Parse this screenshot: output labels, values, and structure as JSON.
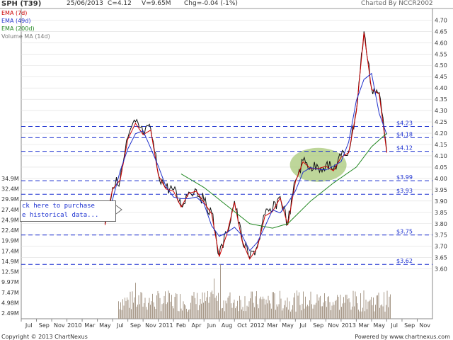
{
  "header": {
    "symbol": "SPH (T39)",
    "date": "25/06/2013",
    "close": "C=4.12",
    "volume": "V=9.65M",
    "change": "Chg=-0.04 (-1%)",
    "credit": "Charted By NCCR2002"
  },
  "legend": [
    {
      "label": "EMA (7d)",
      "color": "#cc0000"
    },
    {
      "label": "EMA (49d)",
      "color": "#2233cc"
    },
    {
      "label": "EMA (200d)",
      "color": "#228822"
    },
    {
      "label": "Volume MA (14d)",
      "color": "#777777"
    }
  ],
  "callout": {
    "line1": "ck here to purchase",
    "line2": "e historical data..."
  },
  "footer": {
    "copyright": "Copyright © 2013 ChartNexus",
    "powered": "Powered by www.chartnexus.com"
  },
  "colors": {
    "price": "#111111",
    "support_line": "#1a2fd0",
    "highlight": "#a8c878"
  },
  "chart_data": {
    "type": "line",
    "title": "SPH (T39)",
    "price_axis": {
      "ticks": [
        "4.70",
        "4.65",
        "4.60",
        "4.55",
        "4.50",
        "4.45",
        "4.40",
        "4.35",
        "4.30",
        "4.25",
        "4.20",
        "4.15",
        "4.10",
        "4.05",
        "4.00",
        "3.95",
        "3.90",
        "3.85",
        "3.80",
        "3.75",
        "3.70",
        "3.65",
        "3.60"
      ],
      "ylim": [
        3.58,
        4.72
      ]
    },
    "volume_axis": {
      "ticks": [
        "34.9M",
        "32.4M",
        "29.9M",
        "27.4M",
        "24.9M",
        "22.4M",
        "19.9M",
        "17.4M",
        "14.9M",
        "12.5M",
        "9.97M",
        "7.47M",
        "4.98M",
        "2.49M"
      ]
    },
    "x_axis_labels": [
      "Jul",
      "Sep",
      "Nov",
      "2010",
      "Mar",
      "May",
      "Jul",
      "Sep",
      "Nov",
      "2011",
      "Feb",
      "Apr",
      "Jun",
      "Aug",
      "Oct",
      "2012",
      "Mar",
      "May",
      "Jul",
      "Sep",
      "Nov",
      "2013",
      "Mar",
      "May",
      "Jul",
      "Sep",
      "Nov"
    ],
    "support_levels": [
      {
        "label": "$4.23",
        "value": 4.23
      },
      {
        "label": "$4.18",
        "value": 4.18
      },
      {
        "label": "$4.12",
        "value": 4.12
      },
      {
        "label": "$3.99",
        "value": 3.99
      },
      {
        "label": "$3.93",
        "value": 3.93
      },
      {
        "label": "$3.75",
        "value": 3.75
      },
      {
        "label": "$3.62",
        "value": 3.62
      }
    ],
    "price_series": [
      {
        "period": "May 2010",
        "value": 3.8
      },
      {
        "period": "Jun 2010",
        "value": 3.96
      },
      {
        "period": "Jul 2010",
        "value": 4.0
      },
      {
        "period": "Aug 2010",
        "value": 4.18
      },
      {
        "period": "Sep 2010",
        "value": 4.25
      },
      {
        "period": "Oct 2010",
        "value": 4.2
      },
      {
        "period": "Nov 2010",
        "value": 4.22
      },
      {
        "period": "Dec 2010",
        "value": 4.02
      },
      {
        "period": "Jan 2011",
        "value": 3.96
      },
      {
        "period": "Feb 2011",
        "value": 3.95
      },
      {
        "period": "Mar 2011",
        "value": 3.88
      },
      {
        "period": "Apr 2011",
        "value": 3.94
      },
      {
        "period": "May 2011",
        "value": 3.95
      },
      {
        "period": "Jun 2011",
        "value": 3.9
      },
      {
        "period": "Jul 2011",
        "value": 3.85
      },
      {
        "period": "Aug 2011",
        "value": 3.66
      },
      {
        "period": "Sep 2011",
        "value": 3.76
      },
      {
        "period": "Oct 2011",
        "value": 3.9
      },
      {
        "period": "Nov 2011",
        "value": 3.73
      },
      {
        "period": "Dec 2011",
        "value": 3.65
      },
      {
        "period": "Jan 2012",
        "value": 3.7
      },
      {
        "period": "Feb 2012",
        "value": 3.84
      },
      {
        "period": "Mar 2012",
        "value": 3.86
      },
      {
        "period": "Apr 2012",
        "value": 3.92
      },
      {
        "period": "May 2012",
        "value": 3.8
      },
      {
        "period": "Jun 2012",
        "value": 3.99
      },
      {
        "period": "Jul 2012",
        "value": 4.08
      },
      {
        "period": "Aug 2012",
        "value": 4.05
      },
      {
        "period": "Sep 2012",
        "value": 4.05
      },
      {
        "period": "Oct 2012",
        "value": 4.06
      },
      {
        "period": "Nov 2012",
        "value": 4.04
      },
      {
        "period": "Dec 2012",
        "value": 4.1
      },
      {
        "period": "Jan 2013",
        "value": 4.12
      },
      {
        "period": "Feb 2013",
        "value": 4.3
      },
      {
        "period": "Mar 2013",
        "value": 4.65
      },
      {
        "period": "Apr 2013",
        "value": 4.4
      },
      {
        "period": "May 2013",
        "value": 4.38
      },
      {
        "period": "Jun 2013",
        "value": 4.12
      }
    ],
    "ema200_series": [
      {
        "period": "Mar 2011",
        "value": 4.02
      },
      {
        "period": "Jun 2011",
        "value": 3.96
      },
      {
        "period": "Sep 2011",
        "value": 3.88
      },
      {
        "period": "Dec 2011",
        "value": 3.8
      },
      {
        "period": "Mar 2012",
        "value": 3.78
      },
      {
        "period": "May 2012",
        "value": 3.8
      },
      {
        "period": "Aug 2012",
        "value": 3.9
      },
      {
        "period": "Nov 2012",
        "value": 3.98
      },
      {
        "period": "Feb 2013",
        "value": 4.05
      },
      {
        "period": "Apr 2013",
        "value": 4.14
      },
      {
        "period": "Jun 2013",
        "value": 4.2
      }
    ]
  }
}
